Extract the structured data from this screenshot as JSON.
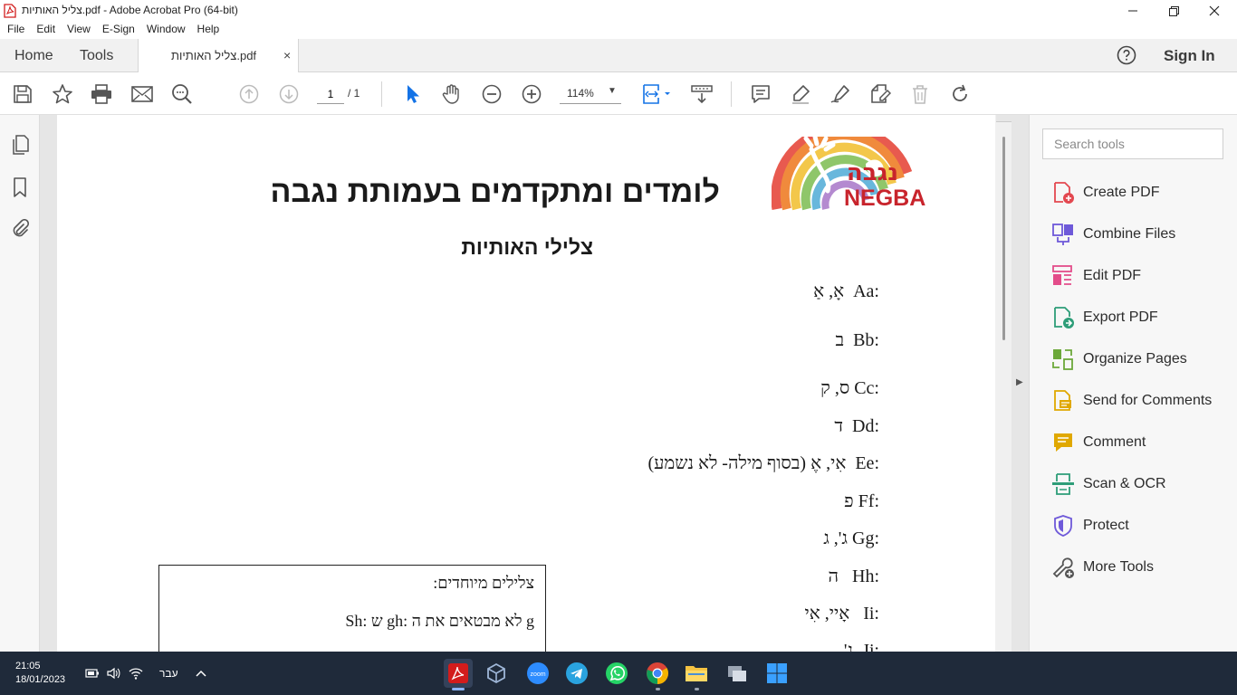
{
  "window": {
    "title": "צליל האותיות.pdf - Adobe Acrobat Pro (64-bit)"
  },
  "menu": [
    "File",
    "Edit",
    "View",
    "E-Sign",
    "Window",
    "Help"
  ],
  "tabs": {
    "home": "Home",
    "tools": "Tools",
    "document": "צליל האותיות.pdf",
    "close": "×",
    "sign_in": "Sign In"
  },
  "toolbar": {
    "page_current": "1",
    "page_total": "/  1",
    "zoom": "114%"
  },
  "document": {
    "logo_text": "NEGBA",
    "logo_hebrew": "נגבה",
    "heading": "לומדים ומתקדמים בעמותת נגבה",
    "subheading": "צלילי האותיות",
    "letters": [
      {
        "latin": "Aa:",
        "hebrew": "אָ, אַ"
      },
      {
        "latin": "Bb:",
        "hebrew": "ב"
      },
      {
        "latin": "Cc:",
        "hebrew": "ס, ק"
      },
      {
        "latin": "Dd:",
        "hebrew": "ד"
      },
      {
        "latin": "Ee:",
        "hebrew": "אִי, אֶ (בסוף מילה- לא נשמע)"
      },
      {
        "latin": "Ff:",
        "hebrew": "פ"
      },
      {
        "latin": "Gg:",
        "hebrew": "ג', ג"
      },
      {
        "latin": "Hh:",
        "hebrew": "ה"
      },
      {
        "latin": "Ii:",
        "hebrew": "אָיי, אִי"
      },
      {
        "latin": "Jj:",
        "hebrew": "ג'"
      }
    ],
    "special": {
      "title": "צלילים מיוחדים:",
      "line": "Sh: ש       gh: לא מבטאים את ה g"
    }
  },
  "tools_pane": {
    "search_placeholder": "Search tools",
    "items": [
      {
        "label": "Create PDF",
        "icon": "create-pdf-icon",
        "color": "#e34850"
      },
      {
        "label": "Combine Files",
        "icon": "combine-files-icon",
        "color": "#6e59d9"
      },
      {
        "label": "Edit PDF",
        "icon": "edit-pdf-icon",
        "color": "#e34d8a"
      },
      {
        "label": "Export PDF",
        "icon": "export-pdf-icon",
        "color": "#2d9d78"
      },
      {
        "label": "Organize Pages",
        "icon": "organize-pages-icon",
        "color": "#6ca83a"
      },
      {
        "label": "Send for Comments",
        "icon": "send-for-comments-icon",
        "color": "#e0a800"
      },
      {
        "label": "Comment",
        "icon": "comment-icon",
        "color": "#e0a800"
      },
      {
        "label": "Scan & OCR",
        "icon": "scan-ocr-icon",
        "color": "#2d9d78"
      },
      {
        "label": "Protect",
        "icon": "protect-icon",
        "color": "#6e59d9"
      },
      {
        "label": "More Tools",
        "icon": "more-tools-icon",
        "color": "#555555"
      }
    ]
  },
  "taskbar": {
    "time": "21:05",
    "date": "18/01/2023",
    "language": "עבר"
  }
}
